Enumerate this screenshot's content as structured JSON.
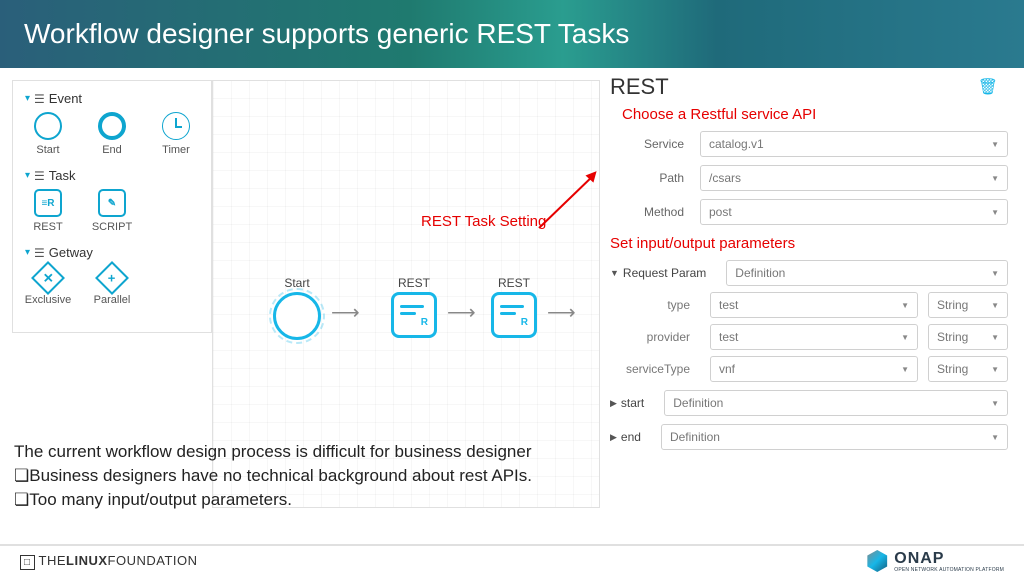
{
  "header": {
    "title": "Workflow designer supports generic REST Tasks"
  },
  "palette": {
    "sections": [
      {
        "label": "Event",
        "items": [
          {
            "name": "start-event",
            "label": "Start"
          },
          {
            "name": "end-event",
            "label": "End"
          },
          {
            "name": "timer-event",
            "label": "Timer"
          }
        ]
      },
      {
        "label": "Task",
        "items": [
          {
            "name": "rest-task",
            "label": "REST"
          },
          {
            "name": "script-task",
            "label": "SCRIPT"
          }
        ]
      },
      {
        "label": "Getway",
        "items": [
          {
            "name": "exclusive-gateway",
            "label": "Exclusive"
          },
          {
            "name": "parallel-gateway",
            "label": "Parallel"
          }
        ]
      }
    ]
  },
  "canvas": {
    "nodes": [
      {
        "name": "start-node",
        "label": "Start"
      },
      {
        "name": "rest-node-1",
        "label": "REST"
      },
      {
        "name": "rest-node-2",
        "label": "REST"
      }
    ],
    "annotation": "REST Task Setting"
  },
  "config": {
    "title": "REST",
    "heading1": "Choose a Restful service API",
    "fields": {
      "service": {
        "label": "Service",
        "value": "catalog.v1"
      },
      "path": {
        "label": "Path",
        "value": "/csars"
      },
      "method": {
        "label": "Method",
        "value": "post"
      }
    },
    "heading2": "Set input/output parameters",
    "requestParam": {
      "label": "Request Param",
      "mode": "Definition"
    },
    "params": [
      {
        "name": "type",
        "value": "test",
        "type": "String"
      },
      {
        "name": "provider",
        "value": "test",
        "type": "String"
      },
      {
        "name": "serviceType",
        "value": "vnf",
        "type": "String"
      }
    ],
    "collapsed": [
      {
        "name": "start",
        "mode": "Definition"
      },
      {
        "name": "end",
        "mode": "Definition"
      }
    ]
  },
  "notes": {
    "line1": "The current workflow design process is difficult for business designer",
    "bullet1": "Business designers have no technical background  about rest APIs.",
    "bullet2": "Too many input/output parameters."
  },
  "footer": {
    "left": "THE LINUX FOUNDATION",
    "right_big": "ONAP",
    "right_small": "OPEN NETWORK AUTOMATION PLATFORM"
  }
}
